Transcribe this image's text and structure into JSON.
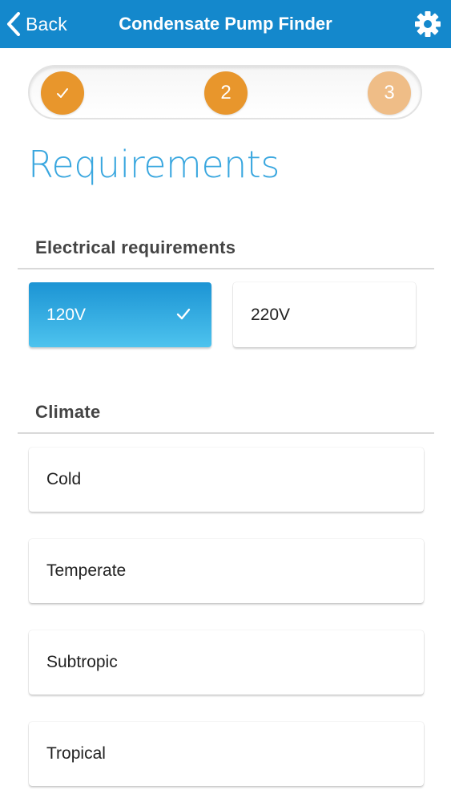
{
  "navbar": {
    "back_label": "Back",
    "title": "Condensate Pump Finder",
    "back_icon": "chevron-left-icon",
    "settings_icon": "gear-icon",
    "color": "#1488cc"
  },
  "progress": {
    "steps": [
      {
        "label": "",
        "state": "completed",
        "icon": "check-icon"
      },
      {
        "label": "2",
        "state": "current"
      },
      {
        "label": "3",
        "state": "upcoming"
      }
    ],
    "accent_color": "#e8962c"
  },
  "page": {
    "title": "Requirements"
  },
  "electrical": {
    "heading": "Electrical requirements",
    "options": [
      {
        "label": "120V",
        "selected": true
      },
      {
        "label": "220V",
        "selected": false
      }
    ]
  },
  "climate": {
    "heading": "Climate",
    "options": [
      {
        "label": "Cold"
      },
      {
        "label": "Temperate"
      },
      {
        "label": "Subtropic"
      },
      {
        "label": "Tropical"
      }
    ]
  }
}
